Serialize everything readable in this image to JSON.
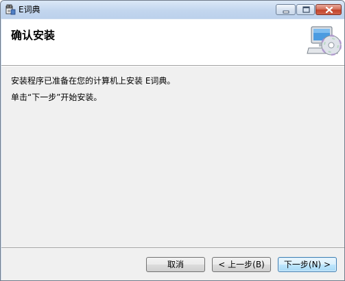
{
  "window": {
    "title": "E词典"
  },
  "header": {
    "title": "确认安装"
  },
  "content": {
    "line1": "安装程序已准备在您的计算机上安装 E词典。",
    "line2": "单击“下一步”开始安装。"
  },
  "buttons": {
    "cancel": "取消",
    "back": "< 上一步(B)",
    "next": "下一步(N) >"
  },
  "icons": {
    "app": "installer-icon",
    "header_art": "computer-cd-icon",
    "minimize": "minimize-icon",
    "maximize": "maximize-icon",
    "close": "close-icon"
  }
}
